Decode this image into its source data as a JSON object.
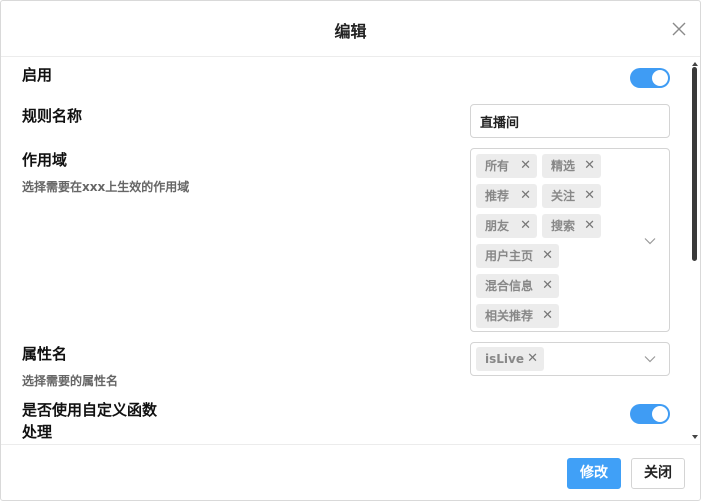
{
  "dialog": {
    "title": "编辑"
  },
  "form": {
    "enable": {
      "label": "启用",
      "value": true
    },
    "rule_name": {
      "label": "规则名称",
      "value": "直播间"
    },
    "scope": {
      "label": "作用域",
      "desc": "选择需要在xxx上生效的作用域",
      "tags": [
        "所有",
        "精选",
        "推荐",
        "关注",
        "朋友",
        "搜索",
        "用户主页",
        "混合信息",
        "相关推荐"
      ]
    },
    "attr": {
      "label": "属性名",
      "desc": "选择需要的属性名",
      "tags": [
        "isLive"
      ]
    },
    "custom_func": {
      "label_line1": "是否使用自定义函数",
      "label_line2": "处理",
      "value": true
    }
  },
  "footer": {
    "confirm_label": "修改",
    "close_label": "关闭"
  },
  "colors": {
    "accent": "#40a0f7",
    "tag_bg": "#ececec"
  }
}
